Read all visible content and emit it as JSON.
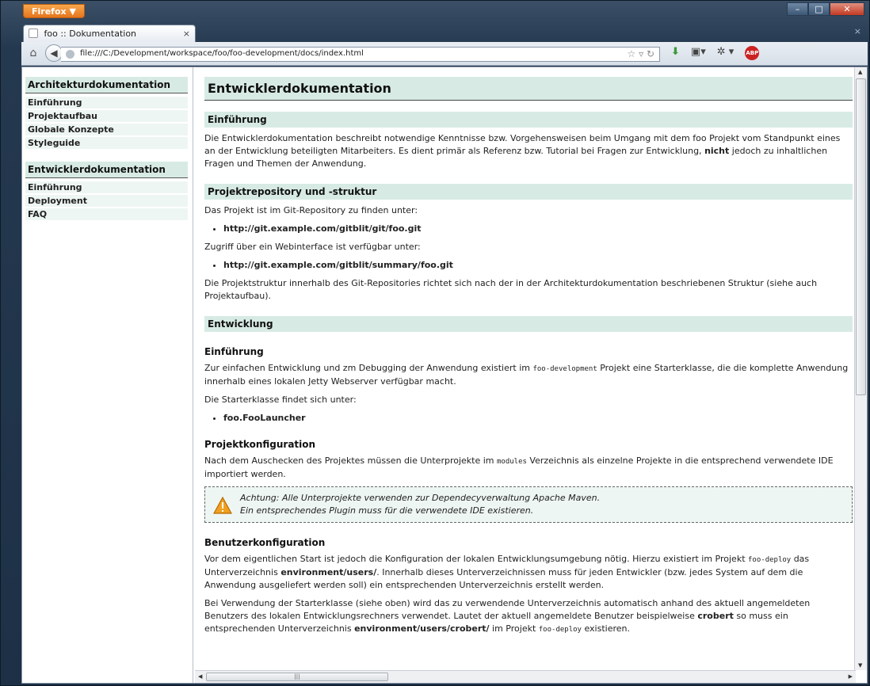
{
  "browser": {
    "app_button": "Firefox ▼",
    "tab_title": "foo :: Dokumentation",
    "tab_close": "×",
    "tabbar_close": "×",
    "url": "file:///C:/Development/workspace/foo/foo-development/docs/index.html"
  },
  "sidebar": {
    "sections": [
      {
        "header": "Architekturdokumentation",
        "items": [
          "Einführung",
          "Projektaufbau",
          "Globale Konzepte",
          "Styleguide"
        ]
      },
      {
        "header": "Entwicklerdokumentation",
        "items": [
          "Einführung",
          "Deployment",
          "FAQ"
        ]
      }
    ]
  },
  "doc": {
    "title": "Entwicklerdokumentation",
    "intro": {
      "heading": "Einführung",
      "text_a": "Die Entwicklerdokumentation beschreibt notwendige Kenntnisse bzw. Vorgehensweisen beim Umgang mit dem foo Projekt vom Standpunkt eines an der Entwicklung beteiligten Mitarbeiters. Es dient primär als Referenz bzw. Tutorial bei Fragen zur Entwicklung, ",
      "text_bold": "nicht",
      "text_b": " jedoch zu inhaltlichen Fragen und Themen der Anwendung."
    },
    "repo": {
      "heading": "Projektrepository und -struktur",
      "text1": "Das Projekt ist im Git-Repository zu finden unter:",
      "link1": "http://git.example.com/gitblit/git/foo.git",
      "text2": "Zugriff über ein Webinterface ist verfügbar unter:",
      "link2": "http://git.example.com/gitblit/summary/foo.git",
      "text3_a": "Die Projektstruktur innerhalb des Git-Repositories richtet sich nach der in der Architekturdokumentation beschriebenen Struktur (siehe auch ",
      "text3_link": "Projektaufbau",
      "text3_b": ")."
    },
    "dev": {
      "heading": "Entwicklung",
      "intro_heading": "Einführung",
      "intro_a": "Zur einfachen Entwicklung und zm Debugging der Anwendung existiert im ",
      "intro_code": "foo-development",
      "intro_b": " Projekt eine Starterklasse, die die komplette Anwendung innerhalb eines lokalen Jetty Webserver verfügbar macht.",
      "starter_text": "Die Starterklasse findet sich unter:",
      "starter_class": "foo.FooLauncher",
      "config_heading": "Projektkonfiguration",
      "config_a": "Nach dem Auschecken des Projektes müssen die Unterprojekte im ",
      "config_code": "modules",
      "config_b": " Verzeichnis als einzelne Projekte in die entsprechend verwendete IDE importiert werden.",
      "warn_line1": "Achtung: Alle Unterprojekte verwenden zur Dependecyverwaltung Apache Maven.",
      "warn_line2": "Ein entsprechendes Plugin muss für die verwendete IDE existieren.",
      "user_heading": "Benutzerkonfiguration",
      "user1_a": "Vor dem eigentlichen Start ist jedoch die Konfiguration der lokalen Entwicklungsumgebung nötig. Hierzu existiert im Projekt ",
      "user1_code": "foo-deploy",
      "user1_b": " das Unterverzeichnis ",
      "user1_bold": "environment/users/",
      "user1_c": ". Innerhalb dieses Unterverzeichnissen muss für jeden Entwickler (bzw. jedes System auf dem die Anwendung ausgeliefert werden soll) ein entsprechenden Unterverzeichnis erstellt werden.",
      "user2_a": "Bei Verwendung der Starterklasse (siehe oben) wird das zu verwendende Unterverzeichnis automatisch anhand des aktuell angemeldeten Benutzers des lokalen Entwicklungsrechners verwendet. Lautet der aktuell angemeldete Benutzer beispielweise ",
      "user2_bold1": "crobert",
      "user2_b": " so muss ein entsprechenden Unterverzeichnis ",
      "user2_bold2": "environment/users/crobert/",
      "user2_c": " im Projekt ",
      "user2_code": "foo-deploy",
      "user2_d": " existieren."
    }
  }
}
